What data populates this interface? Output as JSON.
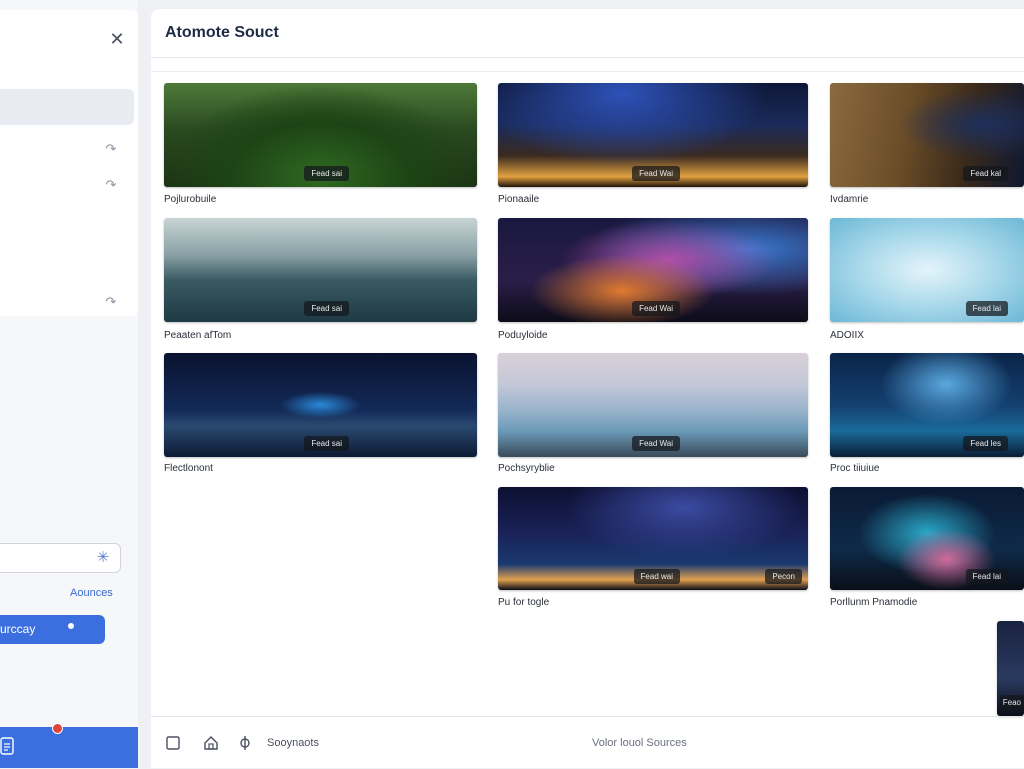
{
  "main": {
    "title": "Atomote Souct"
  },
  "left": {
    "sources_link": "Aounces",
    "primary_button": "urccay"
  },
  "gallery": [
    {
      "caption": "Pojlurobuile",
      "badge": "Fead sai"
    },
    {
      "caption": "Pionaaile",
      "badge": "Fead Wai"
    },
    {
      "caption": "Ivdamrie",
      "badge": "Fead kal"
    },
    {
      "caption": "Peaaten afTom",
      "badge": "Fead sai"
    },
    {
      "caption": "Poduyloide",
      "badge": "Fead Wai"
    },
    {
      "caption": "ADOIIX",
      "badge": "Fead lai"
    },
    {
      "caption": "Flectlonont",
      "badge": "Fead sai"
    },
    {
      "caption": "Pochsyryblie",
      "badge": "Fead Wai"
    },
    {
      "caption": "Proc tiiuiue",
      "badge": "Fead les"
    },
    {
      "caption": "Pu for togle",
      "badge": "Fead wai",
      "badge2": "Pecon"
    },
    {
      "caption": "Porllunm Pnamodie",
      "badge": "Fead lai"
    },
    {
      "caption": "",
      "badge": "Feao"
    }
  ],
  "footer": {
    "label": "Sooynaots",
    "center": "Volor louol Sources"
  },
  "icons": {
    "close": "close-icon",
    "row_arrow": "redo-arrow-icon",
    "search": "sparkle-icon",
    "footer": [
      "checkbox-icon",
      "home-icon",
      "link-icon"
    ],
    "doc": "document-icon"
  }
}
